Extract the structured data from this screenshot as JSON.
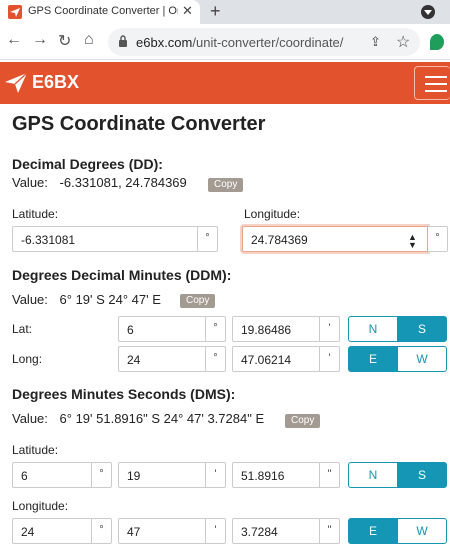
{
  "browser": {
    "tab_title": "GPS Coordinate Converter | Onlin",
    "tab_close": "✕",
    "new_tab": "+",
    "url_domain": "e6bx.com",
    "url_path": "/unit-converter/coordinate/",
    "back": "←",
    "forward": "→",
    "reload": "↻",
    "home": "⌂"
  },
  "site": {
    "logo_text": "E6BX",
    "brand_color": "#e2522d",
    "accent_color": "#1596b4"
  },
  "page": {
    "title": "GPS Coordinate Converter"
  },
  "dd": {
    "title": "Decimal Degrees (DD):",
    "value_label": "Value:",
    "value": "-6.331081, 24.784369",
    "copy": "Copy",
    "lat_label": "Latitude:",
    "lat_value": "-6.331081",
    "lat_unit": "°",
    "lon_label": "Longitude:",
    "lon_value": "24.784369",
    "lon_unit": "°"
  },
  "ddm": {
    "title": "Degrees Decimal Minutes (DDM):",
    "value_label": "Value:",
    "value": "6° 19' S 24° 47' E",
    "copy": "Copy",
    "lat_label": "Lat:",
    "lat_deg": "6",
    "lat_deg_unit": "°",
    "lat_min": "19.86486",
    "lat_min_unit": "'",
    "long_label": "Long:",
    "long_deg": "24",
    "long_deg_unit": "°",
    "long_min": "47.06214",
    "long_min_unit": "'",
    "n": "N",
    "s": "S",
    "e": "E",
    "w": "W"
  },
  "dms": {
    "title": "Degrees Minutes Seconds (DMS):",
    "value_label": "Value:",
    "value": "6° 19' 51.8916\" S 24° 47' 3.7284\" E",
    "copy": "Copy",
    "lat_label": "Latitude:",
    "lat_deg": "6",
    "lat_deg_unit": "°",
    "lat_min": "19",
    "lat_min_unit": "'",
    "lat_sec": "51.8916",
    "lat_sec_unit": "\"",
    "lon_label": "Longitude:",
    "lon_deg": "24",
    "lon_deg_unit": "°",
    "lon_min": "47",
    "lon_min_unit": "'",
    "lon_sec": "3.7284",
    "lon_sec_unit": "\"",
    "n": "N",
    "s": "S",
    "e": "E",
    "w": "W"
  }
}
